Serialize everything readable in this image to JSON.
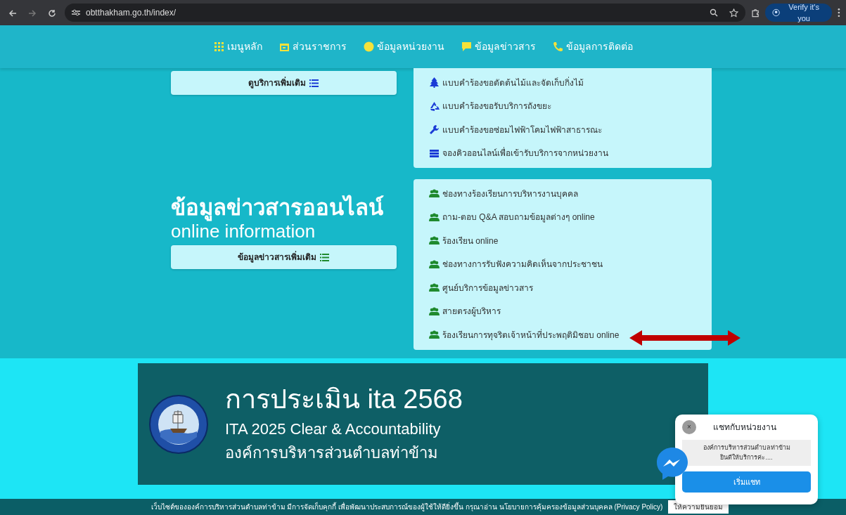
{
  "browser": {
    "url": "obtthakham.go.th/index/",
    "profile_button": "Verify it's you"
  },
  "nav": [
    {
      "kind": "grid",
      "label": "เมนูหลัก"
    },
    {
      "kind": "calendar",
      "label": "ส่วนราชการ"
    },
    {
      "kind": "info",
      "label": "ข้อมูลหน่วยงาน"
    },
    {
      "kind": "chat",
      "label": "ข้อมูลข่าวสาร"
    },
    {
      "kind": "phone",
      "label": "ข้อมูลการติดต่อ"
    }
  ],
  "services": {
    "more_button": "ดูบริการเพิ่มเติม",
    "items": [
      {
        "kind": "tree",
        "label": "แบบคำร้องขอตัดต้นไม้และจัดเก็บกิ่งไม้"
      },
      {
        "kind": "recycle",
        "label": "แบบคำร้องขอรับบริการถังขยะ"
      },
      {
        "kind": "wrench",
        "label": "แบบคำร้องขอซ่อมไฟฟ้าโคมไฟฟ้าสาธารณะ"
      },
      {
        "kind": "queue",
        "label": "จองคิวออนไลน์เพื่อเข้ารับบริการจากหน่วยงาน"
      }
    ]
  },
  "online_info": {
    "title": "ข้อมูลข่าวสารออนไลน์",
    "subtitle": "online information",
    "more_button": "ข้อมูลข่าวสารเพิ่มเติม",
    "items": [
      {
        "kind": "users",
        "label": "ช่องทางร้องเรียนการบริหารงานบุคคล"
      },
      {
        "kind": "users",
        "label": "ถาม-ตอบ Q&A สอบถามข้อมูลต่างๆ online"
      },
      {
        "kind": "users",
        "label": "ร้องเรียน online"
      },
      {
        "kind": "users",
        "label": "ช่องทางการรับฟังความคิดเห็นจากประชาชน"
      },
      {
        "kind": "users",
        "label": "ศูนย์บริการข้อมูลข่าวสาร"
      },
      {
        "kind": "users",
        "label": "สายตรงผู้บริหาร"
      },
      {
        "kind": "users",
        "label": "ร้องเรียนการทุจริตเจ้าหน้าที่ประพฤติมิชอบ online"
      }
    ]
  },
  "ita_banner": {
    "title": "การประเมิน ita 2568",
    "line_1": "ITA 2025 Clear & Accountability",
    "line_2": "องค์การบริหารส่วนตำบลท่าข้าม"
  },
  "chat_popup": {
    "close_button": "×",
    "title": "แชทกับหน่วยงาน",
    "message_line_1": "องค์การบริหารส่วนตำบลท่าข้าม",
    "message_line_2": "ยินดีให้บริการค่ะ....",
    "start_button": "เริ่มแชท"
  },
  "cookie_bar": {
    "text": "เว็บไซต์ขององค์การบริหารส่วนตำบลท่าข้าม มีการจัดเก็บคุกกี้ เพื่อพัฒนาประสบการณ์ของผู้ใช้ให้ดียิ่งขึ้น กรุณาอ่าน นโยบายการคุ้มครองข้อมูลส่วนบุคคล (Privacy Policy)",
    "accept_button": "ให้ความยินยอม"
  }
}
